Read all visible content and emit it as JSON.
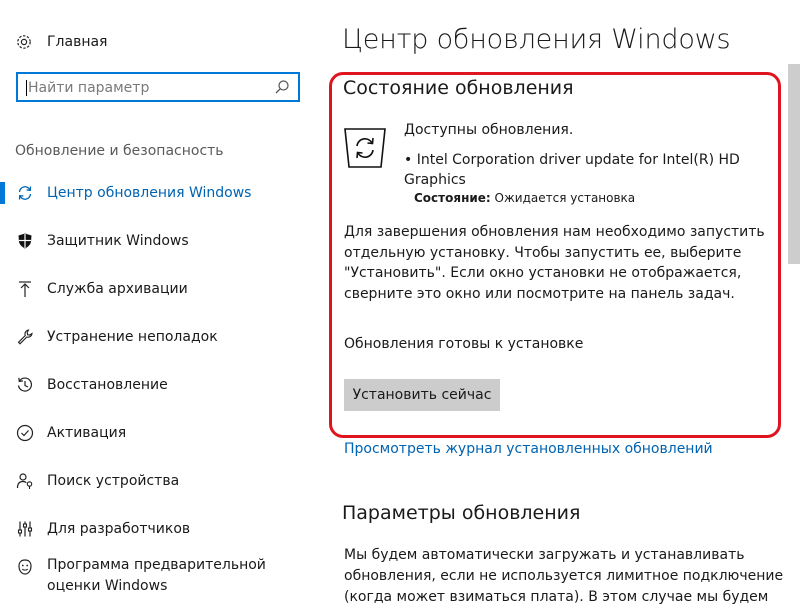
{
  "sidebar": {
    "home_label": "Главная",
    "search_placeholder": "Найти параметр",
    "section_title": "Обновление и безопасность",
    "items": [
      {
        "label": "Центр обновления Windows",
        "icon": "sync-icon",
        "active": true
      },
      {
        "label": "Защитник Windows",
        "icon": "shield-icon"
      },
      {
        "label": "Служба архивации",
        "icon": "upload-arrow-icon"
      },
      {
        "label": "Устранение неполадок",
        "icon": "wrench-icon"
      },
      {
        "label": "Восстановление",
        "icon": "history-icon"
      },
      {
        "label": "Активация",
        "icon": "check-circle-icon"
      },
      {
        "label": "Поиск устройства",
        "icon": "person-location-icon"
      },
      {
        "label": "Для разработчиков",
        "icon": "developer-tools-icon"
      },
      {
        "label": "Программа предварительной оценки Windows",
        "icon": "smiley-icon"
      }
    ]
  },
  "main": {
    "page_title": "Центр обновления Windows",
    "status_section": {
      "title": "Состояние обновления",
      "available": "Доступны обновления.",
      "update_name": "• Intel Corporation driver update for Intel(R) HD Graphics",
      "status_label": "Состояние:",
      "status_value": "Ожидается установка",
      "description": "Для завершения обновления нам необходимо запустить отдельную установку. Чтобы запустить ее, выберите \"Установить\". Если окно установки не отображается, сверните это окно или посмотрите на панель задач.",
      "ready_text": "Обновления готовы к установке",
      "install_button": "Установить сейчас"
    },
    "history_link": "Просмотреть журнал установленных обновлений",
    "params_section": {
      "title": "Параметры обновления",
      "text": "Мы будем автоматически загружать и устанавливать обновления, если не используется лимитное подключение (когда может взиматься плата). В этом случае мы будем"
    }
  },
  "colors": {
    "accent": "#0078d7",
    "link": "#0063b1",
    "highlight_border": "#e0141e",
    "button_bg": "#cccccc"
  }
}
